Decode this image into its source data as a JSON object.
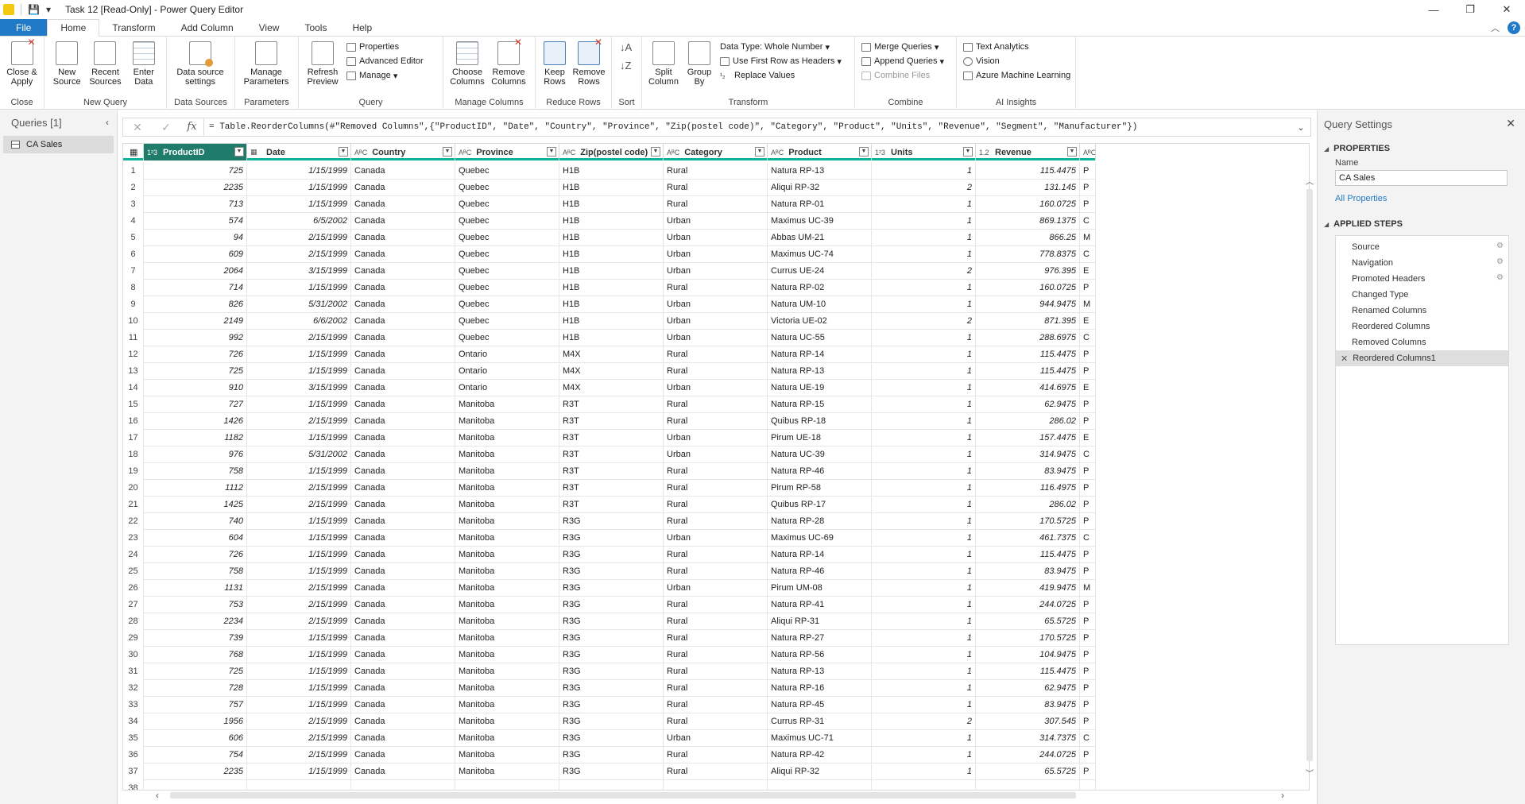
{
  "window": {
    "title": "Task 12 [Read-Only] - Power Query Editor",
    "controls": [
      "—",
      "❐",
      "✕"
    ]
  },
  "tabs": [
    {
      "label": "File"
    },
    {
      "label": "Home"
    },
    {
      "label": "Transform"
    },
    {
      "label": "Add Column"
    },
    {
      "label": "View"
    },
    {
      "label": "Tools"
    },
    {
      "label": "Help"
    }
  ],
  "ribbon": {
    "close": {
      "apply_label": "Close & Apply",
      "group": "Close"
    },
    "new_query": {
      "new_source": "New Source",
      "recent_sources": "Recent Sources",
      "enter_data": "Enter Data",
      "group": "New Query"
    },
    "data_sources": {
      "settings": "Data source settings",
      "group": "Data Sources"
    },
    "parameters": {
      "manage": "Manage Parameters",
      "group": "Parameters"
    },
    "query": {
      "refresh": "Refresh Preview",
      "properties": "Properties",
      "advanced_editor": "Advanced Editor",
      "manage": "Manage",
      "group": "Query"
    },
    "manage_columns": {
      "choose": "Choose Columns",
      "remove": "Remove Columns",
      "group": "Manage Columns"
    },
    "reduce_rows": {
      "keep": "Keep Rows",
      "remove": "Remove Rows",
      "group": "Reduce Rows"
    },
    "sort": {
      "group": "Sort"
    },
    "transform": {
      "split": "Split Column",
      "group_by": "Group By",
      "data_type": "Data Type: Whole Number",
      "first_row": "Use First Row as Headers",
      "replace": "Replace Values",
      "group": "Transform"
    },
    "combine": {
      "merge": "Merge Queries",
      "append": "Append Queries",
      "combine_files": "Combine Files",
      "group": "Combine"
    },
    "ai": {
      "text_analytics": "Text Analytics",
      "vision": "Vision",
      "azure_ml": "Azure Machine Learning",
      "group": "AI Insights"
    }
  },
  "queries_pane": {
    "title": "Queries [1]",
    "items": [
      {
        "label": "CA Sales"
      }
    ]
  },
  "formula": "= Table.ReorderColumns(#\"Removed Columns\",{\"ProductID\", \"Date\", \"Country\", \"Province\", \"Zip(postel code)\", \"Category\", \"Product\", \"Units\", \"Revenue\", \"Segment\", \"Manufacturer\"})",
  "grid": {
    "columns": [
      {
        "type": "1²3",
        "label": "ProductID"
      },
      {
        "type": "▦",
        "label": "Date"
      },
      {
        "type": "AᴮC",
        "label": "Country"
      },
      {
        "type": "AᴮC",
        "label": "Province"
      },
      {
        "type": "AᴮC",
        "label": "Zip(postel code)"
      },
      {
        "type": "AᴮC",
        "label": "Category"
      },
      {
        "type": "AᴮC",
        "label": "Product"
      },
      {
        "type": "1²3",
        "label": "Units"
      },
      {
        "type": "1.2",
        "label": "Revenue"
      },
      {
        "type": "AᴮC",
        "label": "S"
      }
    ],
    "rows": [
      [
        "1",
        "725",
        "1/15/1999",
        "Canada",
        "Quebec",
        "H1B",
        "Rural",
        "Natura RP-13",
        "1",
        "115.4475",
        "P"
      ],
      [
        "2",
        "2235",
        "1/15/1999",
        "Canada",
        "Quebec",
        "H1B",
        "Rural",
        "Aliqui RP-32",
        "2",
        "131.145",
        "P"
      ],
      [
        "3",
        "713",
        "1/15/1999",
        "Canada",
        "Quebec",
        "H1B",
        "Rural",
        "Natura RP-01",
        "1",
        "160.0725",
        "P"
      ],
      [
        "4",
        "574",
        "6/5/2002",
        "Canada",
        "Quebec",
        "H1B",
        "Urban",
        "Maximus UC-39",
        "1",
        "869.1375",
        "C"
      ],
      [
        "5",
        "94",
        "2/15/1999",
        "Canada",
        "Quebec",
        "H1B",
        "Urban",
        "Abbas UM-21",
        "1",
        "866.25",
        "M"
      ],
      [
        "6",
        "609",
        "2/15/1999",
        "Canada",
        "Quebec",
        "H1B",
        "Urban",
        "Maximus UC-74",
        "1",
        "778.8375",
        "C"
      ],
      [
        "7",
        "2064",
        "3/15/1999",
        "Canada",
        "Quebec",
        "H1B",
        "Urban",
        "Currus UE-24",
        "2",
        "976.395",
        "E"
      ],
      [
        "8",
        "714",
        "1/15/1999",
        "Canada",
        "Quebec",
        "H1B",
        "Rural",
        "Natura RP-02",
        "1",
        "160.0725",
        "P"
      ],
      [
        "9",
        "826",
        "5/31/2002",
        "Canada",
        "Quebec",
        "H1B",
        "Urban",
        "Natura UM-10",
        "1",
        "944.9475",
        "M"
      ],
      [
        "10",
        "2149",
        "6/6/2002",
        "Canada",
        "Quebec",
        "H1B",
        "Urban",
        "Victoria UE-02",
        "2",
        "871.395",
        "E"
      ],
      [
        "11",
        "992",
        "2/15/1999",
        "Canada",
        "Quebec",
        "H1B",
        "Urban",
        "Natura UC-55",
        "1",
        "288.6975",
        "C"
      ],
      [
        "12",
        "726",
        "1/15/1999",
        "Canada",
        "Ontario",
        "M4X",
        "Rural",
        "Natura RP-14",
        "1",
        "115.4475",
        "P"
      ],
      [
        "13",
        "725",
        "1/15/1999",
        "Canada",
        "Ontario",
        "M4X",
        "Rural",
        "Natura RP-13",
        "1",
        "115.4475",
        "P"
      ],
      [
        "14",
        "910",
        "3/15/1999",
        "Canada",
        "Ontario",
        "M4X",
        "Urban",
        "Natura UE-19",
        "1",
        "414.6975",
        "E"
      ],
      [
        "15",
        "727",
        "1/15/1999",
        "Canada",
        "Manitoba",
        "R3T",
        "Rural",
        "Natura RP-15",
        "1",
        "62.9475",
        "P"
      ],
      [
        "16",
        "1426",
        "2/15/1999",
        "Canada",
        "Manitoba",
        "R3T",
        "Rural",
        "Quibus RP-18",
        "1",
        "286.02",
        "P"
      ],
      [
        "17",
        "1182",
        "1/15/1999",
        "Canada",
        "Manitoba",
        "R3T",
        "Urban",
        "Pirum UE-18",
        "1",
        "157.4475",
        "E"
      ],
      [
        "18",
        "976",
        "5/31/2002",
        "Canada",
        "Manitoba",
        "R3T",
        "Urban",
        "Natura UC-39",
        "1",
        "314.9475",
        "C"
      ],
      [
        "19",
        "758",
        "1/15/1999",
        "Canada",
        "Manitoba",
        "R3T",
        "Rural",
        "Natura RP-46",
        "1",
        "83.9475",
        "P"
      ],
      [
        "20",
        "1112",
        "2/15/1999",
        "Canada",
        "Manitoba",
        "R3T",
        "Rural",
        "Pirum RP-58",
        "1",
        "116.4975",
        "P"
      ],
      [
        "21",
        "1425",
        "2/15/1999",
        "Canada",
        "Manitoba",
        "R3T",
        "Rural",
        "Quibus RP-17",
        "1",
        "286.02",
        "P"
      ],
      [
        "22",
        "740",
        "1/15/1999",
        "Canada",
        "Manitoba",
        "R3G",
        "Rural",
        "Natura RP-28",
        "1",
        "170.5725",
        "P"
      ],
      [
        "23",
        "604",
        "1/15/1999",
        "Canada",
        "Manitoba",
        "R3G",
        "Urban",
        "Maximus UC-69",
        "1",
        "461.7375",
        "C"
      ],
      [
        "24",
        "726",
        "1/15/1999",
        "Canada",
        "Manitoba",
        "R3G",
        "Rural",
        "Natura RP-14",
        "1",
        "115.4475",
        "P"
      ],
      [
        "25",
        "758",
        "1/15/1999",
        "Canada",
        "Manitoba",
        "R3G",
        "Rural",
        "Natura RP-46",
        "1",
        "83.9475",
        "P"
      ],
      [
        "26",
        "1131",
        "2/15/1999",
        "Canada",
        "Manitoba",
        "R3G",
        "Urban",
        "Pirum UM-08",
        "1",
        "419.9475",
        "M"
      ],
      [
        "27",
        "753",
        "2/15/1999",
        "Canada",
        "Manitoba",
        "R3G",
        "Rural",
        "Natura RP-41",
        "1",
        "244.0725",
        "P"
      ],
      [
        "28",
        "2234",
        "2/15/1999",
        "Canada",
        "Manitoba",
        "R3G",
        "Rural",
        "Aliqui RP-31",
        "1",
        "65.5725",
        "P"
      ],
      [
        "29",
        "739",
        "1/15/1999",
        "Canada",
        "Manitoba",
        "R3G",
        "Rural",
        "Natura RP-27",
        "1",
        "170.5725",
        "P"
      ],
      [
        "30",
        "768",
        "1/15/1999",
        "Canada",
        "Manitoba",
        "R3G",
        "Rural",
        "Natura RP-56",
        "1",
        "104.9475",
        "P"
      ],
      [
        "31",
        "725",
        "1/15/1999",
        "Canada",
        "Manitoba",
        "R3G",
        "Rural",
        "Natura RP-13",
        "1",
        "115.4475",
        "P"
      ],
      [
        "32",
        "728",
        "1/15/1999",
        "Canada",
        "Manitoba",
        "R3G",
        "Rural",
        "Natura RP-16",
        "1",
        "62.9475",
        "P"
      ],
      [
        "33",
        "757",
        "1/15/1999",
        "Canada",
        "Manitoba",
        "R3G",
        "Rural",
        "Natura RP-45",
        "1",
        "83.9475",
        "P"
      ],
      [
        "34",
        "1956",
        "2/15/1999",
        "Canada",
        "Manitoba",
        "R3G",
        "Rural",
        "Currus RP-31",
        "2",
        "307.545",
        "P"
      ],
      [
        "35",
        "606",
        "2/15/1999",
        "Canada",
        "Manitoba",
        "R3G",
        "Urban",
        "Maximus UC-71",
        "1",
        "314.7375",
        "C"
      ],
      [
        "36",
        "754",
        "2/15/1999",
        "Canada",
        "Manitoba",
        "R3G",
        "Rural",
        "Natura RP-42",
        "1",
        "244.0725",
        "P"
      ],
      [
        "37",
        "2235",
        "1/15/1999",
        "Canada",
        "Manitoba",
        "R3G",
        "Rural",
        "Aliqui RP-32",
        "1",
        "65.5725",
        "P"
      ],
      [
        "38",
        "",
        "",
        "",
        "",
        "",
        "",
        "",
        "",
        "",
        ""
      ]
    ]
  },
  "settings": {
    "title": "Query Settings",
    "properties_header": "PROPERTIES",
    "name_label": "Name",
    "name_value": "CA Sales",
    "all_properties": "All Properties",
    "steps_header": "APPLIED STEPS",
    "steps": [
      {
        "label": "Source",
        "gear": true
      },
      {
        "label": "Navigation",
        "gear": true
      },
      {
        "label": "Promoted Headers",
        "gear": true
      },
      {
        "label": "Changed Type",
        "gear": false
      },
      {
        "label": "Renamed Columns",
        "gear": false
      },
      {
        "label": "Reordered Columns",
        "gear": false
      },
      {
        "label": "Removed Columns",
        "gear": false
      },
      {
        "label": "Reordered Columns1",
        "gear": false,
        "active": true
      }
    ]
  },
  "colors": {
    "accent": "#217ac7",
    "header_underline": "#10b39a",
    "selected_column": "#1f7c6b"
  }
}
